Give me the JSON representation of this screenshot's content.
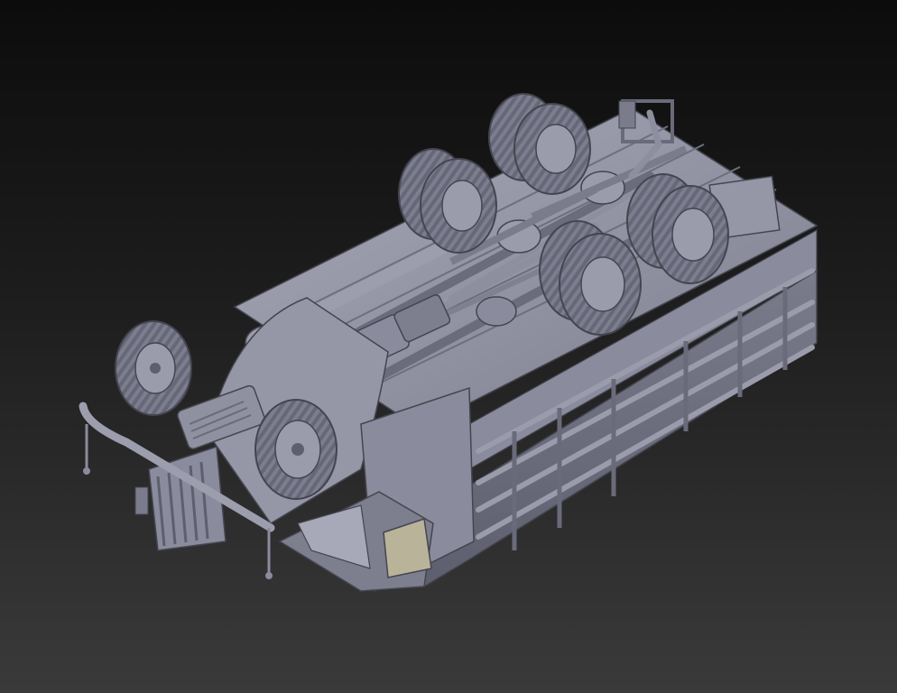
{
  "scene": {
    "background_top": "#0c0c0c",
    "background_bottom": "#3a3a3a",
    "model_base": "#8a8b9c",
    "model_light": "#a7a8b8",
    "model_shadow": "#5e5f6e",
    "model_dark": "#44454f",
    "tire_color": "#7c7d8e",
    "window_tint": "#b9b39a"
  }
}
